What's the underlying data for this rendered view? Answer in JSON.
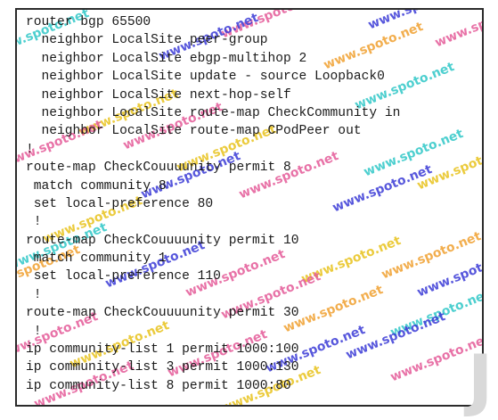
{
  "config_lines": [
    "router bgp 65500",
    "  neighbor LocalSite peer-group",
    "  neighbor LocalSite ebgp-multihop 2",
    "  neighbor LocalSite update - source Loopback0",
    "  neighbor LocalSite next-hop-self",
    "  neighbor LocalSite route-map CheckCommunity in",
    "  neighbor LocalSite route-map CPodPeer out",
    "!",
    "route-map CheckCouuuunity permit 8",
    " match community 8",
    " set local-preference 80",
    " !",
    "route-map CheckCouuuunity permit 10",
    " match community 1",
    " set local-preference 110",
    " !",
    "route-map CheckCouuuunity permit 30",
    " !",
    "ip community-list 1 permit 1000:100",
    "ip community-list 3 permit 1000:130",
    "ip community-list 8 permit 1000:80"
  ],
  "watermark_text": "www.spoto.net",
  "watermark_colors": [
    "#3a3ad6",
    "#e8c21c",
    "#e45a98",
    "#2ec7c7",
    "#f0a030"
  ],
  "corner_glyph": "J"
}
